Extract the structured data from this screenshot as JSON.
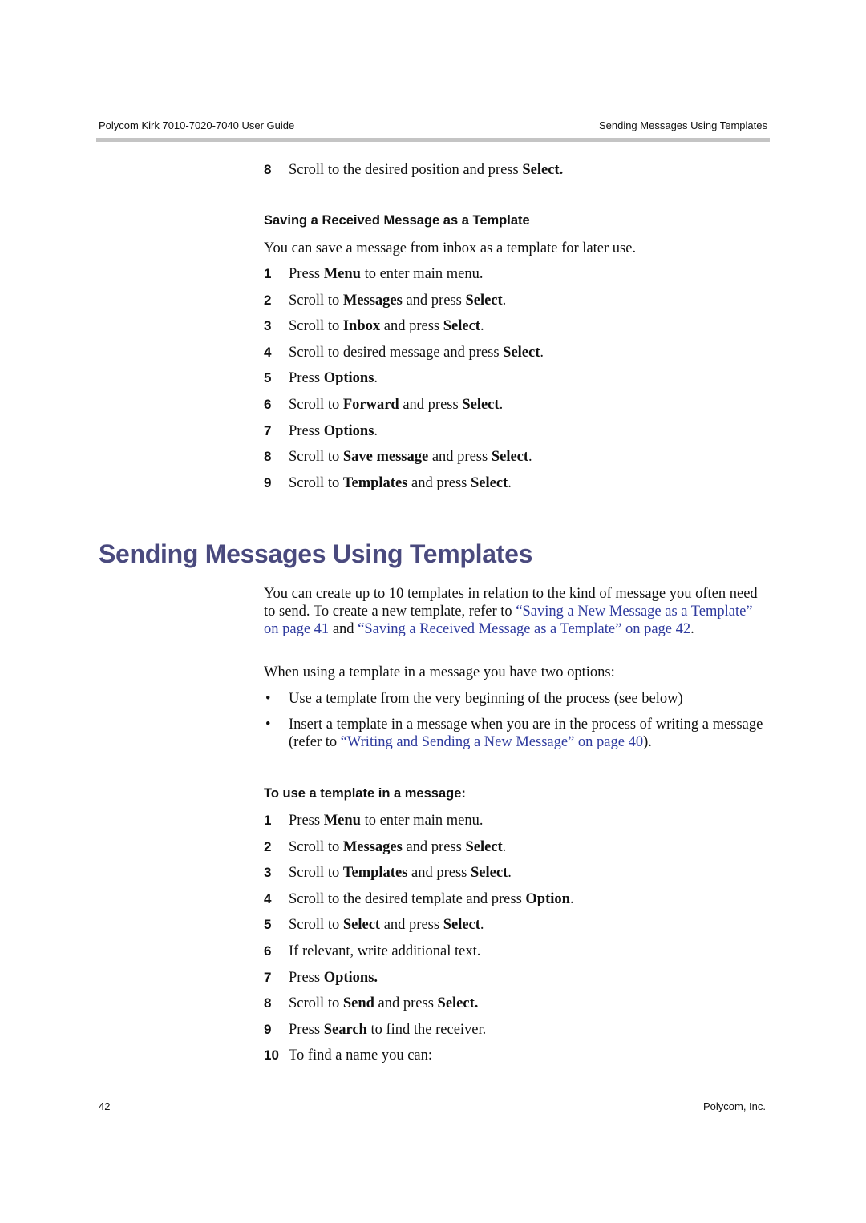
{
  "header": {
    "doc_title": "Polycom Kirk 7010-7020-7040 User Guide",
    "section_title": "Sending Messages Using Templates"
  },
  "prev_step": {
    "num": "8",
    "pre": "Scroll to the desired position and press ",
    "bold": "Select."
  },
  "saving_section": {
    "heading": "Saving a Received Message as a Template",
    "intro": "You can save a message from inbox as a template for later use.",
    "steps": [
      {
        "num": "1",
        "parts": [
          [
            "Press ",
            false
          ],
          [
            "Menu",
            true
          ],
          [
            " to enter main menu.",
            false
          ]
        ]
      },
      {
        "num": "2",
        "parts": [
          [
            "Scroll to ",
            false
          ],
          [
            "Messages",
            true
          ],
          [
            " and press ",
            false
          ],
          [
            "Select",
            true
          ],
          [
            ".",
            false
          ]
        ]
      },
      {
        "num": "3",
        "parts": [
          [
            "Scroll to ",
            false
          ],
          [
            "Inbox",
            true
          ],
          [
            " and press ",
            false
          ],
          [
            "Select",
            true
          ],
          [
            ".",
            false
          ]
        ]
      },
      {
        "num": "4",
        "parts": [
          [
            "Scroll to desired message and press ",
            false
          ],
          [
            "Select",
            true
          ],
          [
            ".",
            false
          ]
        ]
      },
      {
        "num": "5",
        "parts": [
          [
            "Press ",
            false
          ],
          [
            "Options",
            true
          ],
          [
            ".",
            false
          ]
        ]
      },
      {
        "num": "6",
        "parts": [
          [
            "Scroll to ",
            false
          ],
          [
            "Forward",
            true
          ],
          [
            " and press ",
            false
          ],
          [
            "Select",
            true
          ],
          [
            ".",
            false
          ]
        ]
      },
      {
        "num": "7",
        "parts": [
          [
            "Press ",
            false
          ],
          [
            "Options",
            true
          ],
          [
            ".",
            false
          ]
        ]
      },
      {
        "num": "8",
        "parts": [
          [
            "Scroll to ",
            false
          ],
          [
            "Save message",
            true
          ],
          [
            " and press ",
            false
          ],
          [
            "Select",
            true
          ],
          [
            ".",
            false
          ]
        ]
      },
      {
        "num": "9",
        "parts": [
          [
            "Scroll to ",
            false
          ],
          [
            "Templates",
            true
          ],
          [
            " and press ",
            false
          ],
          [
            "Select",
            true
          ],
          [
            ".",
            false
          ]
        ]
      }
    ]
  },
  "main_section": {
    "title": "Sending Messages Using Templates",
    "intro_pre": "You can create up to 10 templates in relation to the kind of message you often need to send. To create a new template, refer to ",
    "link1": "“Saving a New Message as a Template” on page 41",
    "intro_mid": " and ",
    "link2": "“Saving a Received Message as a Template” on page 42",
    "intro_post": ".",
    "options_intro": "When using a template in a message you have two options:",
    "bullets": {
      "b1": "Use a template from the very beginning of the process (see below)",
      "b2_pre": "Insert a template in a message when you are in the process of writing a message (refer to ",
      "b2_link": "“Writing and Sending a New Message” on page 40",
      "b2_post": ")."
    },
    "procedure_heading": "To use a template in a message:",
    "steps": [
      {
        "num": "1",
        "parts": [
          [
            "Press ",
            false
          ],
          [
            "Menu",
            true
          ],
          [
            " to enter main menu.",
            false
          ]
        ]
      },
      {
        "num": "2",
        "parts": [
          [
            "Scroll to ",
            false
          ],
          [
            "Messages",
            true
          ],
          [
            " and press ",
            false
          ],
          [
            "Select",
            true
          ],
          [
            ".",
            false
          ]
        ]
      },
      {
        "num": "3",
        "parts": [
          [
            "Scroll to ",
            false
          ],
          [
            "Templates",
            true
          ],
          [
            " and press ",
            false
          ],
          [
            "Select",
            true
          ],
          [
            ".",
            false
          ]
        ]
      },
      {
        "num": "4",
        "parts": [
          [
            "Scroll to the desired template and press ",
            false
          ],
          [
            "Option",
            true
          ],
          [
            ".",
            false
          ]
        ]
      },
      {
        "num": "5",
        "parts": [
          [
            "Scroll to ",
            false
          ],
          [
            "Select",
            true
          ],
          [
            " and press ",
            false
          ],
          [
            "Select",
            true
          ],
          [
            ".",
            false
          ]
        ]
      },
      {
        "num": "6",
        "parts": [
          [
            "If relevant, write additional text.",
            false
          ]
        ]
      },
      {
        "num": "7",
        "parts": [
          [
            "Press ",
            false
          ],
          [
            "Options.",
            true
          ]
        ]
      },
      {
        "num": "8",
        "parts": [
          [
            "Scroll to ",
            false
          ],
          [
            "Send",
            true
          ],
          [
            " and press ",
            false
          ],
          [
            "Select.",
            true
          ]
        ]
      },
      {
        "num": "9",
        "parts": [
          [
            "Press ",
            false
          ],
          [
            "Search",
            true
          ],
          [
            " to find the receiver.",
            false
          ]
        ]
      },
      {
        "num": "10",
        "parts": [
          [
            "To find a name you can:",
            false
          ]
        ]
      }
    ]
  },
  "footer": {
    "page_number": "42",
    "company": "Polycom, Inc."
  }
}
